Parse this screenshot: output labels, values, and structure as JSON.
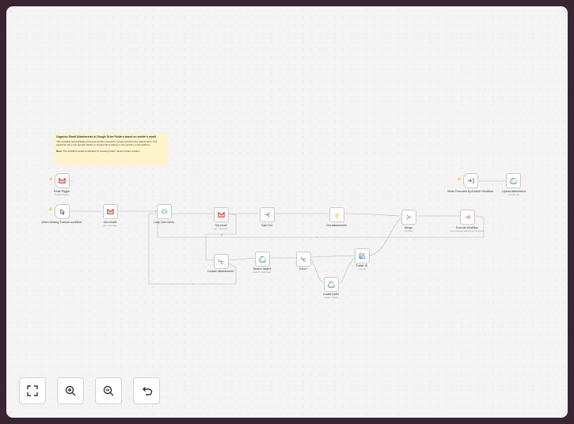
{
  "note": {
    "title": "Organise Gmail Attachments in Google Drive Folders based on sender's email",
    "body": "This workflow automatically processes emails received in Gmail, extracts their attachments, and organizes them into specific folders in Google Drive based on the sender's email address.",
    "hint_bold": "Note:",
    "hint": "The workflow avoids duplicates by checking folder names before creation."
  },
  "nodes": {
    "email_trigger": {
      "label": "Email Trigger",
      "sub": "Gmail Trigger"
    },
    "manual_trigger": {
      "label": "When clicking 'Execute workflow'",
      "sub": ""
    },
    "get_emails": {
      "label": "Get emails",
      "sub": "get: message"
    },
    "loop": {
      "label": "Loop Over Items",
      "sub": ""
    },
    "get_email": {
      "label": "Get email",
      "sub": "get: message"
    },
    "split_out": {
      "label": "Split Out",
      "sub": ""
    },
    "get_attachments": {
      "label": "Get attachments",
      "sub": ""
    },
    "merge": {
      "label": "Merge",
      "sub": "combine"
    },
    "execute_workflow": {
      "label": "Execute Workflow",
      "sub": "Call 'Upload attachment to Drive'"
    },
    "contain_attachments": {
      "label": "Contain attachments?",
      "sub": ""
    },
    "search_folders": {
      "label": "Search folders",
      "sub": "search: fileFolder"
    },
    "if_exist": {
      "label": "Exist?",
      "sub": ""
    },
    "create_folder": {
      "label": "Create folder",
      "sub": "create: folder"
    },
    "folder_id": {
      "label": "Folder ID",
      "sub": "manual"
    },
    "executed_trigger": {
      "label": "When Executed by Another Workflow",
      "sub": ""
    },
    "upload_attachment": {
      "label": "Upload attachment",
      "sub": "upload: file"
    }
  },
  "icons": {
    "gmail": "gmail-icon",
    "drive": "google-drive-icon",
    "loop": "loop-icon",
    "split": "split-out-icon",
    "code": "code-icon",
    "merge": "merge-icon",
    "execute": "execute-workflow-icon",
    "if": "if-icon",
    "edit": "edit-fields-icon",
    "cursor": "manual-trigger-icon",
    "subflow": "workflow-trigger-icon"
  },
  "colors": {
    "note": "#fff5cc",
    "trigger": "#ff6d5a",
    "canvas": "#f4f4f5",
    "border": "#3a2433"
  },
  "controls": [
    "fit-view",
    "zoom-in",
    "zoom-out",
    "reset-zoom"
  ]
}
